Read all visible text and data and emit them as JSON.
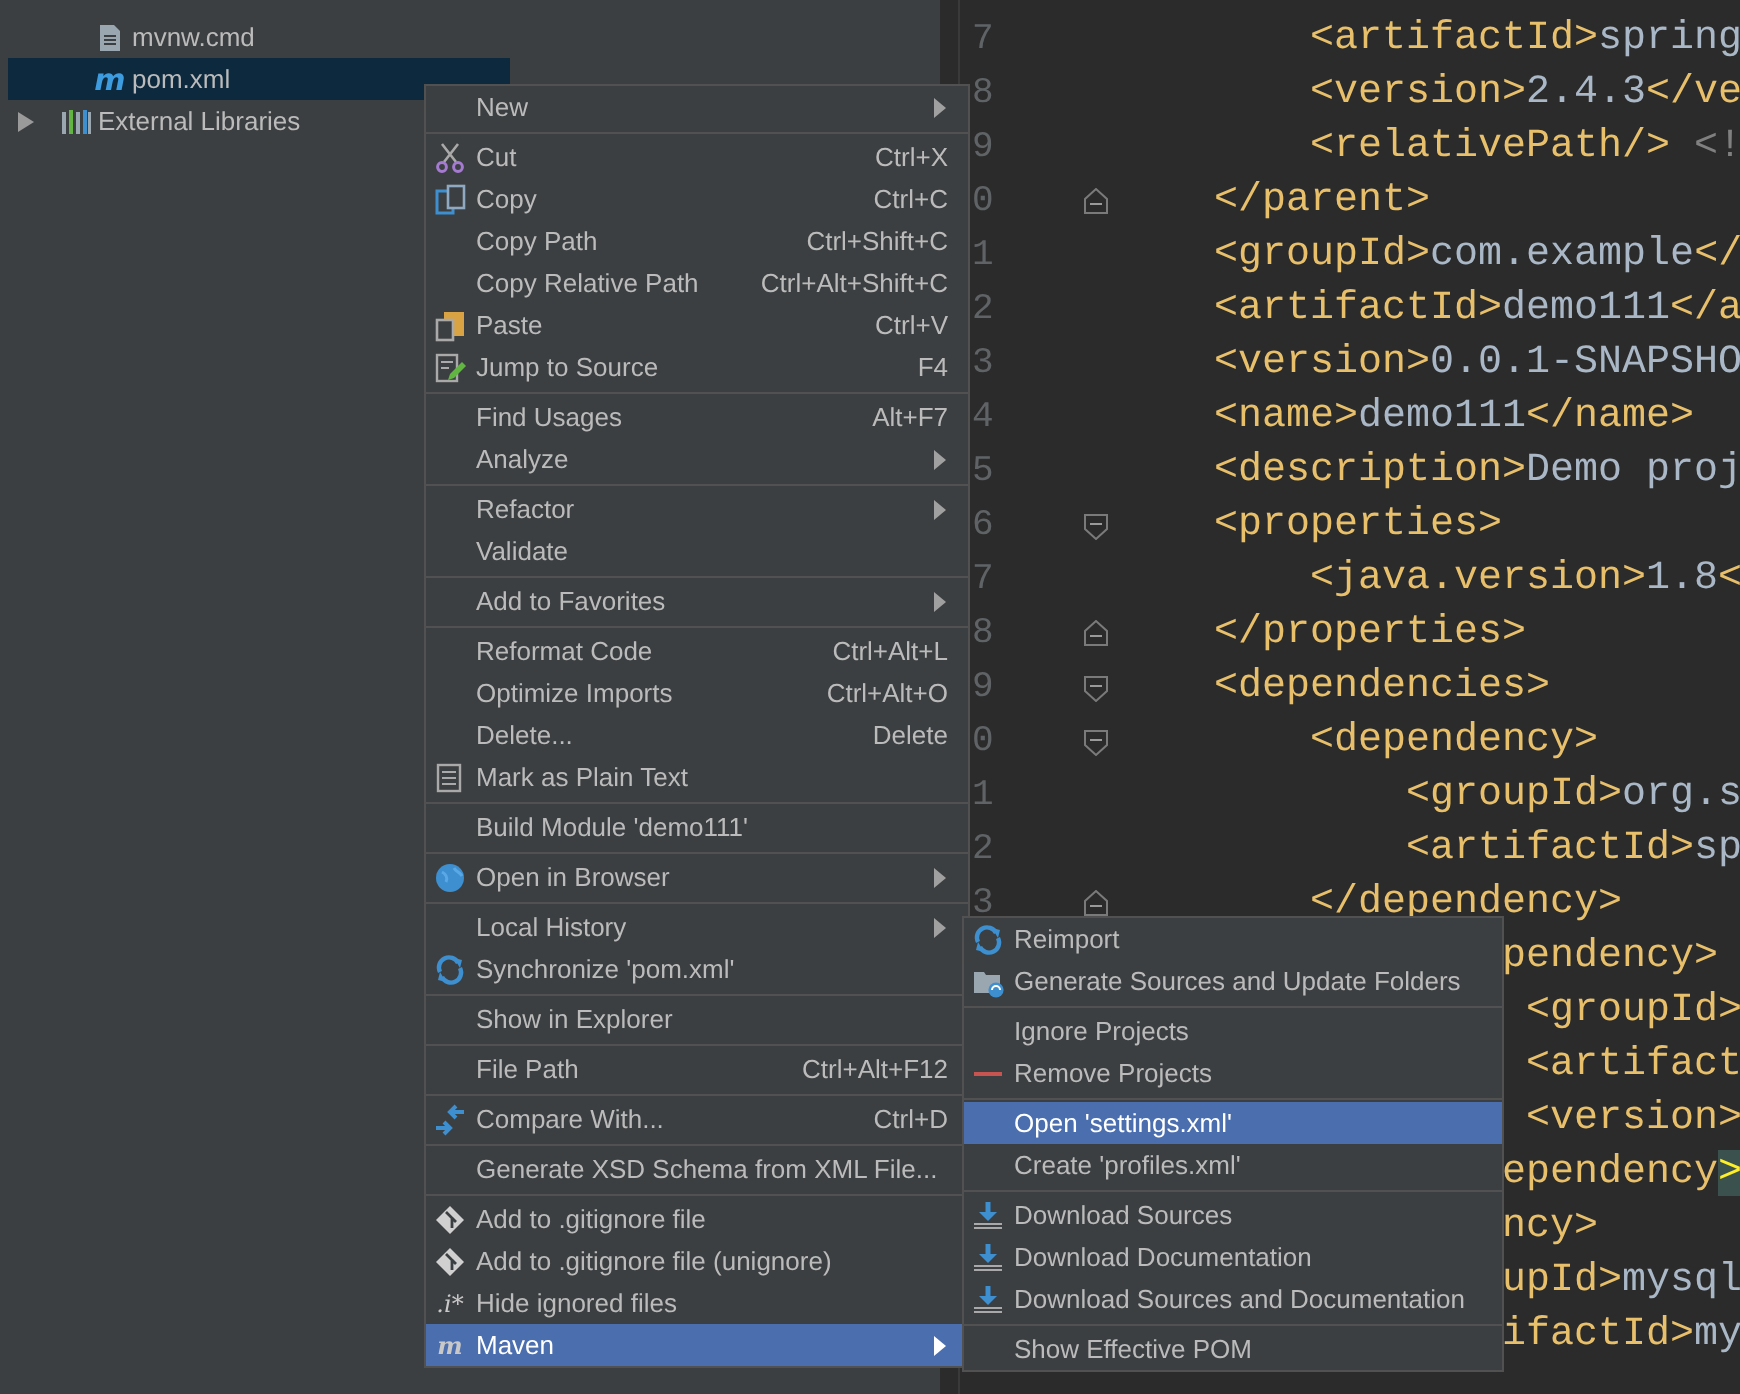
{
  "project_tree": {
    "items": [
      {
        "label": "mvnw.cmd",
        "kind": "file",
        "selected": false
      },
      {
        "label": "pom.xml",
        "kind": "maven",
        "icon_text": "m",
        "selected": true
      },
      {
        "label": "External Libraries",
        "kind": "library",
        "selected": false
      }
    ]
  },
  "editor": {
    "lines": [
      {
        "num": "7",
        "kind": "plain",
        "parts": [
          {
            "kind": "tag",
            "t": "<artifactId>"
          },
          {
            "kind": "text",
            "t": "spring"
          }
        ]
      },
      {
        "num": "8",
        "kind": "plain",
        "parts": [
          {
            "kind": "tag",
            "t": "<version>"
          },
          {
            "kind": "text",
            "t": "2.4.3"
          },
          {
            "kind": "tag",
            "t": "</ve"
          }
        ]
      },
      {
        "num": "9",
        "kind": "plain",
        "parts": [
          {
            "kind": "tag",
            "t": "<relativePath/>"
          },
          {
            "kind": "comment",
            "t": " <!"
          }
        ]
      },
      {
        "num": "0",
        "kind": "fold-end",
        "parts": [
          {
            "kind": "tag",
            "t": "</parent>"
          }
        ]
      },
      {
        "num": "1",
        "kind": "plain",
        "parts": [
          {
            "kind": "tag",
            "t": "<groupId>"
          },
          {
            "kind": "text",
            "t": "com.example"
          },
          {
            "kind": "tag",
            "t": "</"
          }
        ]
      },
      {
        "num": "2",
        "kind": "plain",
        "parts": [
          {
            "kind": "tag",
            "t": "<artifactId>"
          },
          {
            "kind": "text",
            "t": "demo111"
          },
          {
            "kind": "tag",
            "t": "</a"
          }
        ]
      },
      {
        "num": "3",
        "kind": "plain",
        "parts": [
          {
            "kind": "tag",
            "t": "<version>"
          },
          {
            "kind": "text",
            "t": "0.0.1-SNAPSHO"
          }
        ]
      },
      {
        "num": "4",
        "kind": "plain",
        "parts": [
          {
            "kind": "tag",
            "t": "<name>"
          },
          {
            "kind": "text",
            "t": "demo111"
          },
          {
            "kind": "tag",
            "t": "</name>"
          }
        ]
      },
      {
        "num": "5",
        "kind": "plain",
        "parts": [
          {
            "kind": "tag",
            "t": "<description>"
          },
          {
            "kind": "text",
            "t": "Demo proj"
          }
        ]
      },
      {
        "num": "6",
        "kind": "fold-start",
        "parts": [
          {
            "kind": "tag",
            "t": "<properties>"
          }
        ]
      },
      {
        "num": "7",
        "kind": "plain",
        "parts": [
          {
            "kind": "tag",
            "t": "<java.version>"
          },
          {
            "kind": "text",
            "t": "1.8"
          },
          {
            "kind": "tag",
            "t": "<"
          }
        ]
      },
      {
        "num": "8",
        "kind": "fold-end",
        "parts": [
          {
            "kind": "tag",
            "t": "</properties>"
          }
        ]
      },
      {
        "num": "9",
        "kind": "fold-start",
        "parts": [
          {
            "kind": "tag",
            "t": "<dependencies>"
          }
        ]
      },
      {
        "num": "0",
        "kind": "fold-start",
        "parts": [
          {
            "kind": "tag",
            "t": "<dependency>"
          }
        ]
      },
      {
        "num": "1",
        "kind": "plain",
        "parts": [
          {
            "kind": "tag",
            "t": "<groupId>"
          },
          {
            "kind": "text",
            "t": "org.s"
          }
        ]
      },
      {
        "num": "2",
        "kind": "plain",
        "parts": [
          {
            "kind": "tag",
            "t": "<artifactId>"
          },
          {
            "kind": "text",
            "t": "sp"
          }
        ]
      },
      {
        "num": "3",
        "kind": "fold-end",
        "parts": [
          {
            "kind": "tag",
            "t": "</dependency>"
          }
        ]
      },
      {
        "kind": "plain",
        "parts": [
          {
            "kind": "tag",
            "t": "pendency>"
          }
        ]
      },
      {
        "kind": "plain",
        "parts": [
          {
            "kind": "tag",
            "t": "<groupId>"
          }
        ]
      },
      {
        "kind": "plain",
        "parts": [
          {
            "kind": "tag",
            "t": "<artifact"
          }
        ]
      },
      {
        "kind": "plain",
        "parts": [
          {
            "kind": "tag",
            "t": "<version>"
          }
        ]
      },
      {
        "kind": "plain",
        "parts": [
          {
            "kind": "tag",
            "t": "ependency"
          },
          {
            "kind": "match",
            "t": ">"
          }
        ]
      },
      {
        "kind": "plain",
        "parts": [
          {
            "kind": "tag",
            "t": "ncy>"
          }
        ]
      },
      {
        "kind": "plain",
        "parts": [
          {
            "kind": "tag",
            "t": "upId>"
          },
          {
            "kind": "text",
            "t": "mysql"
          }
        ]
      },
      {
        "kind": "plain",
        "parts": [
          {
            "kind": "tag",
            "t": "ifactId>"
          },
          {
            "kind": "text",
            "t": "my"
          }
        ]
      }
    ]
  },
  "context_menu": {
    "items": [
      {
        "kind": "item",
        "label": "New",
        "submenu": true,
        "selected": false
      },
      {
        "kind": "separator"
      },
      {
        "kind": "item",
        "label": "Cut",
        "shortcut": "Ctrl+X",
        "submenu": false,
        "selected": false
      },
      {
        "kind": "item",
        "label": "Copy",
        "shortcut": "Ctrl+C",
        "submenu": false,
        "selected": false
      },
      {
        "kind": "item",
        "label": "Copy Path",
        "shortcut": "Ctrl+Shift+C",
        "submenu": false,
        "selected": false
      },
      {
        "kind": "item",
        "label": "Copy Relative Path",
        "shortcut": "Ctrl+Alt+Shift+C",
        "submenu": false,
        "selected": false
      },
      {
        "kind": "item",
        "label": "Paste",
        "shortcut": "Ctrl+V",
        "submenu": false,
        "selected": false
      },
      {
        "kind": "item",
        "label": "Jump to Source",
        "shortcut": "F4",
        "submenu": false,
        "selected": false
      },
      {
        "kind": "separator"
      },
      {
        "kind": "item",
        "label": "Find Usages",
        "shortcut": "Alt+F7",
        "submenu": false,
        "selected": false
      },
      {
        "kind": "item",
        "label": "Analyze",
        "submenu": true,
        "selected": false
      },
      {
        "kind": "separator"
      },
      {
        "kind": "item",
        "label": "Refactor",
        "submenu": true,
        "selected": false
      },
      {
        "kind": "item",
        "label": "Validate",
        "submenu": false,
        "selected": false
      },
      {
        "kind": "separator"
      },
      {
        "kind": "item",
        "label": "Add to Favorites",
        "submenu": true,
        "selected": false
      },
      {
        "kind": "separator"
      },
      {
        "kind": "item",
        "label": "Reformat Code",
        "shortcut": "Ctrl+Alt+L",
        "submenu": false,
        "selected": false
      },
      {
        "kind": "item",
        "label": "Optimize Imports",
        "shortcut": "Ctrl+Alt+O",
        "submenu": false,
        "selected": false
      },
      {
        "kind": "item",
        "label": "Delete...",
        "shortcut": "Delete",
        "submenu": false,
        "selected": false
      },
      {
        "kind": "item",
        "label": "Mark as Plain Text",
        "submenu": false,
        "selected": false
      },
      {
        "kind": "separator"
      },
      {
        "kind": "item",
        "label": "Build Module 'demo111'",
        "submenu": false,
        "selected": false
      },
      {
        "kind": "separator"
      },
      {
        "kind": "item",
        "label": "Open in Browser",
        "submenu": true,
        "selected": false
      },
      {
        "kind": "separator"
      },
      {
        "kind": "item",
        "label": "Local History",
        "submenu": true,
        "selected": false
      },
      {
        "kind": "item",
        "label": "Synchronize 'pom.xml'",
        "submenu": false,
        "selected": false
      },
      {
        "kind": "separator"
      },
      {
        "kind": "item",
        "label": "Show in Explorer",
        "submenu": false,
        "selected": false
      },
      {
        "kind": "separator"
      },
      {
        "kind": "item",
        "label": "File Path",
        "shortcut": "Ctrl+Alt+F12",
        "submenu": false,
        "selected": false
      },
      {
        "kind": "separator"
      },
      {
        "kind": "item",
        "label": "Compare With...",
        "shortcut": "Ctrl+D",
        "submenu": false,
        "selected": false
      },
      {
        "kind": "separator"
      },
      {
        "kind": "item",
        "label": "Generate XSD Schema from XML File...",
        "submenu": false,
        "selected": false
      },
      {
        "kind": "separator"
      },
      {
        "kind": "item",
        "label": "Add to .gitignore file",
        "submenu": false,
        "selected": false
      },
      {
        "kind": "item",
        "label": "Add to .gitignore file (unignore)",
        "submenu": false,
        "selected": false
      },
      {
        "kind": "item",
        "label": "Hide ignored files",
        "icon_text": ".i*",
        "submenu": false,
        "selected": false
      },
      {
        "kind": "item",
        "label": "Maven",
        "icon_text": "m",
        "submenu": true,
        "selected": true
      }
    ]
  },
  "maven_submenu": {
    "items": [
      {
        "kind": "item",
        "label": "Reimport",
        "selected": false
      },
      {
        "kind": "item",
        "label": "Generate Sources and Update Folders",
        "selected": false
      },
      {
        "kind": "separator"
      },
      {
        "kind": "item",
        "label": "Ignore Projects",
        "selected": false
      },
      {
        "kind": "item",
        "label": "Remove Projects",
        "selected": false
      },
      {
        "kind": "separator"
      },
      {
        "kind": "item",
        "label": "Open 'settings.xml'",
        "selected": true
      },
      {
        "kind": "item",
        "label": "Create 'profiles.xml'",
        "selected": false
      },
      {
        "kind": "separator"
      },
      {
        "kind": "item",
        "label": "Download Sources",
        "selected": false
      },
      {
        "kind": "item",
        "label": "Download Documentation",
        "selected": false
      },
      {
        "kind": "item",
        "label": "Download Sources and Documentation",
        "selected": false
      },
      {
        "kind": "separator"
      },
      {
        "kind": "item",
        "label": "Show Effective POM",
        "selected": false
      }
    ]
  }
}
